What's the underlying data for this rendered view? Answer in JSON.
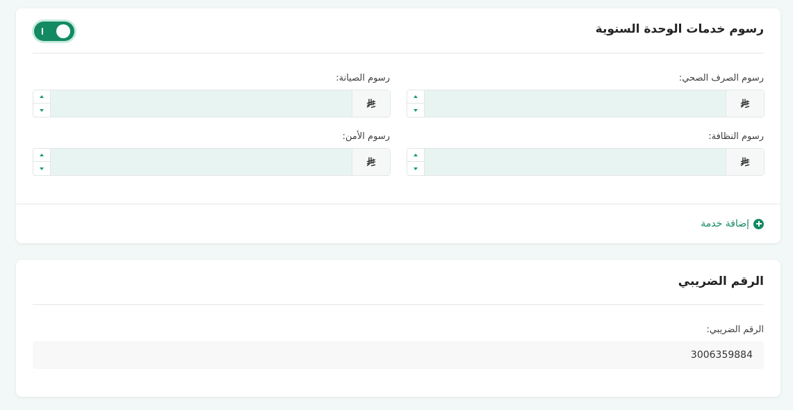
{
  "fees_card": {
    "title": "رسوم خدمات الوحدة السنوية",
    "toggle_on": true,
    "fields": [
      {
        "label": "رسوم الصرف الصحي:",
        "value": "",
        "currency_icon": "saudi-riyal-icon"
      },
      {
        "label": "رسوم الصيانة:",
        "value": "",
        "currency_icon": "saudi-riyal-icon"
      },
      {
        "label": "رسوم النظافة:",
        "value": "",
        "currency_icon": "saudi-riyal-icon"
      },
      {
        "label": "رسوم الأمن:",
        "value": "",
        "currency_icon": "saudi-riyal-icon"
      }
    ],
    "add_service_label": "إضافة خدمة"
  },
  "tax_card": {
    "title": "الرقم الضريبي",
    "label": "الرقم الضريبي:",
    "value": "3006359884"
  },
  "colors": {
    "accent": "#138a62",
    "page_bg": "#f2f8f7",
    "input_bg": "#e8f4f1"
  }
}
